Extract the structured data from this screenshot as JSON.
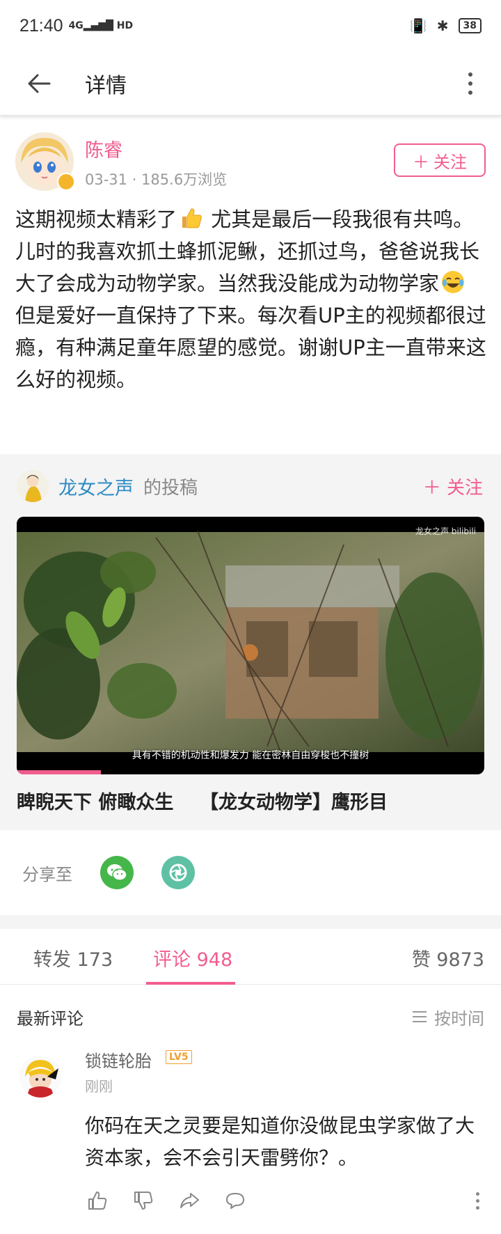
{
  "status_bar": {
    "time": "21:40",
    "network": "4G",
    "hd": "HD",
    "battery": "38"
  },
  "app_bar": {
    "title": "详情"
  },
  "post": {
    "author": "陈睿",
    "date": "03-31",
    "views": "185.6万浏览",
    "follow_label": "关注",
    "text_1": "这期视频太精彩了",
    "text_2": " 尤其是最后一段我很有共鸣。儿时的我喜欢抓土蜂抓泥鳅，还抓过鸟，爸爸说我长大了会成为动物学家。当然我没能成为动物学家",
    "text_3": " 但是爱好一直保持了下来。每次看UP主的视频都很过瘾，有种满足童年愿望的感觉。谢谢UP主一直带来这么好的视频。"
  },
  "repost": {
    "author": "龙女之声",
    "suffix": "的投稿",
    "follow_label": "关注",
    "video": {
      "caption": "具有不错的机动性和爆发力 能在密林自由穿梭也不撞树",
      "watermark": "龙女之声 bilibili",
      "progress": 0.18
    },
    "title": "睥睨天下 俯瞰众生    【龙女动物学】鹰形目"
  },
  "share": {
    "label": "分享至"
  },
  "tabs": {
    "repost": "转发 173",
    "comments": "评论 948",
    "likes": "赞 9873"
  },
  "comments": {
    "title": "最新评论",
    "sort": "按时间",
    "items": [
      {
        "user": "锁链轮胎",
        "level": "LV5",
        "time": "刚刚",
        "text": "你码在天之灵要是知道你没做昆虫学家做了大资本家，会不会引天雷劈你？。"
      }
    ]
  },
  "colors": {
    "accent": "#f25d8e",
    "link": "#2e8bc5",
    "wechat": "#45b649",
    "moments": "#5ec1a4"
  }
}
